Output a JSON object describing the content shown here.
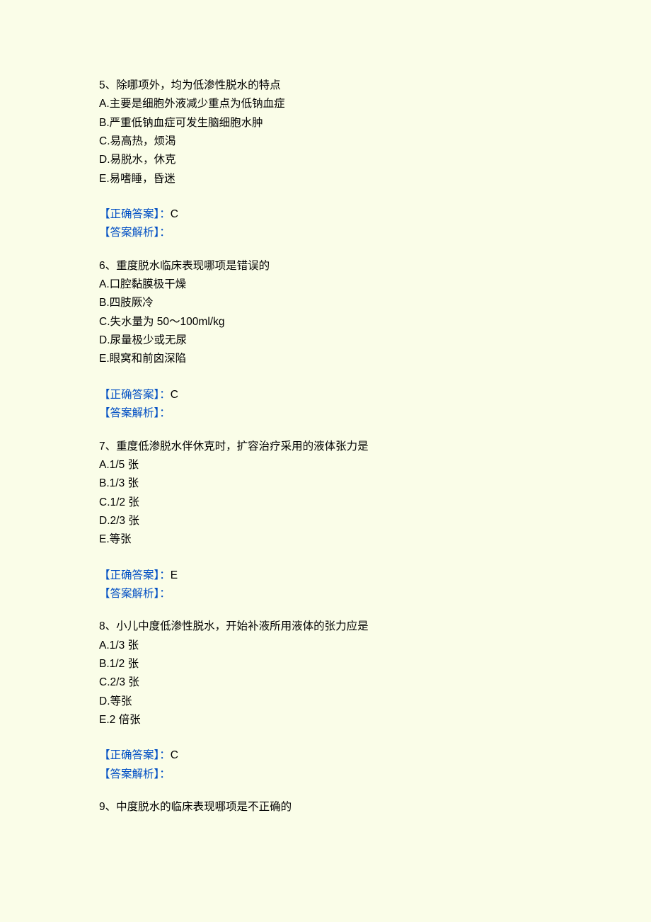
{
  "questions": [
    {
      "number": "5、",
      "stem": "除哪项外，均为低渗性脱水的特点",
      "options": [
        "A.主要是细胞外液减少重点为低钠血症",
        "B.严重低钠血症可发生脑细胞水肿",
        "C.易高热，烦渴",
        "D.易脱水，休克",
        "E.易嗜睡，昏迷"
      ],
      "answer_label": "【正确答案】：",
      "answer_value": "C",
      "analysis_label": "【答案解析】："
    },
    {
      "number": "6、",
      "stem": "重度脱水临床表现哪项是错误的",
      "options": [
        "A.口腔黏膜极干燥",
        "B.四肢厥冷",
        "C.失水量为 50～100ml/kg",
        "D.尿量极少或无尿",
        "E.眼窝和前囟深陷"
      ],
      "answer_label": "【正确答案】：",
      "answer_value": "C",
      "analysis_label": "【答案解析】："
    },
    {
      "number": "7、",
      "stem": "重度低渗脱水伴休克时，扩容治疗采用的液体张力是",
      "options": [
        "A.1/5 张",
        "B.1/3 张",
        "C.1/2 张",
        "D.2/3 张",
        "E.等张"
      ],
      "answer_label": "【正确答案】：",
      "answer_value": "E",
      "analysis_label": "【答案解析】："
    },
    {
      "number": "8、",
      "stem": "小儿中度低渗性脱水，开始补液所用液体的张力应是",
      "options": [
        "A.1/3 张",
        "B.1/2 张",
        "C.2/3 张",
        "D.等张",
        "E.2 倍张"
      ],
      "answer_label": "【正确答案】：",
      "answer_value": "C",
      "analysis_label": "【答案解析】："
    },
    {
      "number": "9、",
      "stem": "中度脱水的临床表现哪项是不正确的",
      "options": [],
      "answer_label": "",
      "answer_value": "",
      "analysis_label": ""
    }
  ]
}
